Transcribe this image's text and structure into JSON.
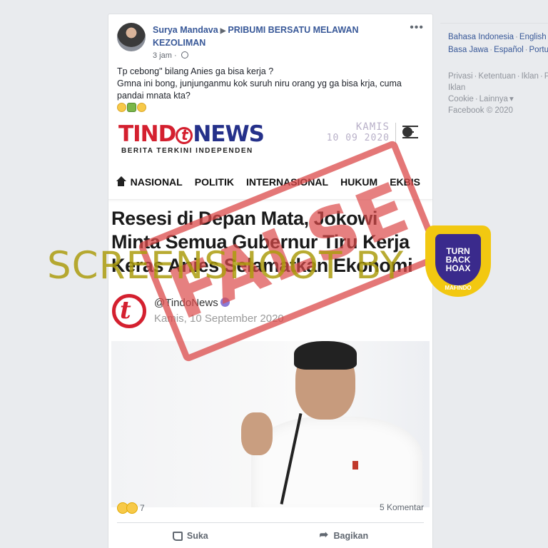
{
  "post": {
    "author": "Surya Mandava",
    "arrow": "▶",
    "group": "PRIBUMI BERSATU MELAWAN KEZOLIMAN",
    "time": "3 jam",
    "more": "•••",
    "text_line1": "Tp cebong\" bilang Anies ga bisa kerja ?",
    "text_line2": "Gmna ini bong, junjunganmu kok suruh niru orang yg ga bisa krja, cuma pandai mnata kta?"
  },
  "article": {
    "logo_tind": "TIND",
    "logo_t": "t",
    "logo_news": "NEWS",
    "tagline": "BERITA TERKINI INDEPENDEN",
    "day": "KAMIS",
    "date": "10 09 2020",
    "nav": [
      "NASIONAL",
      "POLITIK",
      "INTERNASIONAL",
      "HUKUM",
      "EKBIS"
    ],
    "headline": "Resesi di Depan Mata, Jokowi Minta Semua Gubernur Tiru Kerja Keras Anies Selamatkan Ekonomi",
    "source_name": "@TindoNews",
    "source_date": "Kamis, 10 September 2020"
  },
  "overlays": {
    "stamp": "FALSE",
    "watermark": "SCREENSHOOT BY",
    "badge_line1": "TURN",
    "badge_line2": "BACK",
    "badge_line3": "HOAX",
    "badge_name": "MAFINDO"
  },
  "engagement": {
    "reaction_count": "7",
    "comments": "5 Komentar",
    "like": "Suka",
    "share": "Bagikan"
  },
  "sidebar": {
    "languages": [
      "Bahasa Indonesia",
      "English (US)",
      "Basa Jawa",
      "Español",
      "Português (Brasil)"
    ],
    "footer_links": [
      "Privasi",
      "Ketentuan",
      "Iklan",
      "Pilihan Iklan",
      "Cookie",
      "Lainnya"
    ],
    "copyright": "Facebook © 2020"
  },
  "colors": {
    "facebook_link": "#385898",
    "tindo_red": "#d4202f",
    "tindo_blue": "#25318a",
    "stamp_red": "#db4a4a",
    "watermark_olive": "#ac9c0e",
    "mafindo_yellow": "#f2c811",
    "mafindo_purple": "#3a2a8c"
  }
}
